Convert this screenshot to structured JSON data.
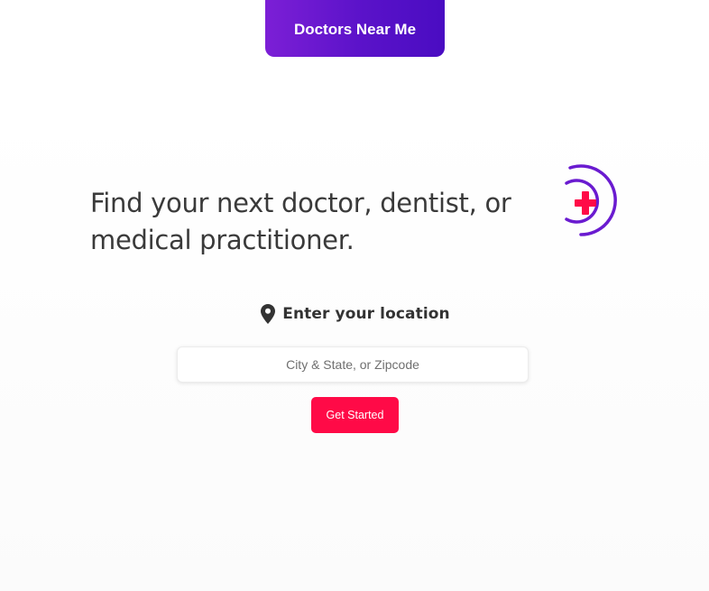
{
  "header": {
    "brand_label": "Doctors Near Me"
  },
  "hero": {
    "headline": "Find your next doctor, dentist, or medical practitioner."
  },
  "search": {
    "location_label": "Enter your location",
    "placeholder": "City & State, or Zipcode",
    "value": "",
    "submit_label": "Get Started"
  },
  "colors": {
    "brand_gradient_start": "#7c1fd6",
    "brand_gradient_end": "#4a0cc2",
    "accent_red": "#ff0a47",
    "logo_arc": "#6a1bd0",
    "logo_cross": "#ff0a47",
    "text_dark": "#3a3a3a"
  },
  "icons": {
    "logo": "medical-cross-signal-icon",
    "location": "map-pin-icon"
  }
}
